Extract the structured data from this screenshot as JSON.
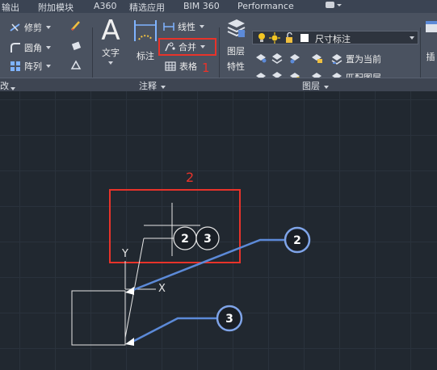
{
  "tabs": [
    "输出",
    "附加模块",
    "A360",
    "精选应用",
    "BIM 360",
    "Performance"
  ],
  "modify": {
    "trim_label": "修剪",
    "fillet_label": "圆角",
    "array_label": "阵列"
  },
  "annotation": {
    "text_label": "文字",
    "dimension_label": "标注",
    "linear_label": "线性",
    "merge_label": "合并",
    "table_label": "表格",
    "panel_title": "注释"
  },
  "layers": {
    "properties_label_1": "图层",
    "properties_label_2": "特性",
    "current_layer": "尺寸标注",
    "set_current_label": "置为当前",
    "match_label": "匹配图层",
    "panel_title": "图层"
  },
  "insert_label": "插",
  "panel_left_fragment": "改",
  "callouts": {
    "one": "1",
    "two": "2"
  },
  "balloons": {
    "grouped": [
      "2",
      "3"
    ],
    "single_top": "2",
    "single_bottom": "3"
  },
  "ucs": {
    "x_label": "X",
    "y_label": "Y"
  },
  "colors": {
    "ribbon": "#4a5260",
    "canvas": "#212830",
    "callout_red": "#e8332a",
    "leader_blue": "#5c8ad8",
    "layer_bulb": "#f3c623"
  }
}
